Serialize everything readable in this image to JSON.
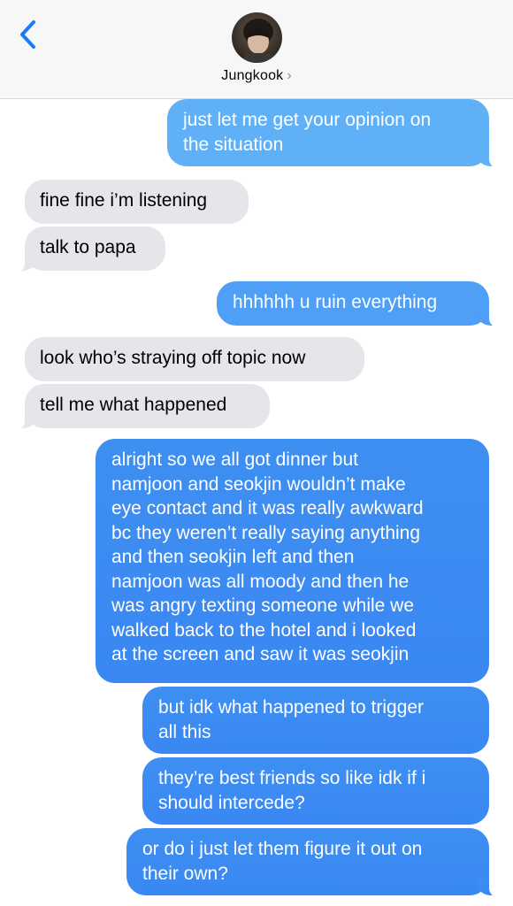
{
  "header": {
    "contact_name": "Jungkook",
    "chevron": "›",
    "back_icon": "chevron-left-icon",
    "accent_color": "#1a7cf5"
  },
  "messages": [
    {
      "from": "me",
      "lines": [
        "just let me get your opinion on",
        "the situation"
      ]
    },
    {
      "from": "them",
      "lines": [
        "fine fine i’m listening"
      ]
    },
    {
      "from": "them",
      "lines": [
        "talk to papa"
      ]
    },
    {
      "from": "me",
      "lines": [
        "hhhhhh u ruin everything"
      ]
    },
    {
      "from": "them",
      "lines": [
        "look who’s straying off topic now"
      ]
    },
    {
      "from": "them",
      "lines": [
        "tell me what happened"
      ]
    },
    {
      "from": "me",
      "lines": [
        "alright so we all got dinner but",
        "namjoon and seokjin wouldn’t make",
        "eye contact and it was really awkward",
        "bc they weren’t really saying anything",
        "and then seokjin left and then",
        "namjoon was all moody and then he",
        "was angry texting someone while we",
        "walked back to the hotel and i looked",
        "at the screen and saw it was seokjin"
      ]
    },
    {
      "from": "me",
      "lines": [
        "but idk what happened to trigger",
        "all this"
      ]
    },
    {
      "from": "me",
      "lines": [
        "they’re best friends so like idk if i",
        "should intercede?"
      ]
    },
    {
      "from": "me",
      "lines": [
        "or do i just let them figure it out on",
        "their own?"
      ]
    }
  ]
}
